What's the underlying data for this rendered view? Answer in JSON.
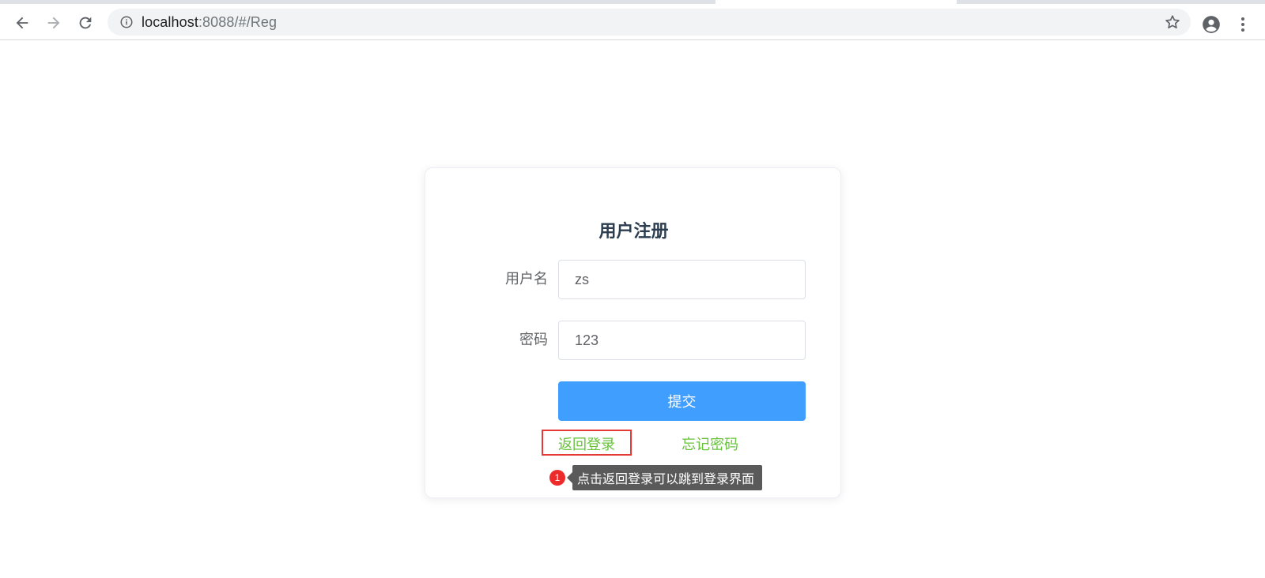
{
  "browser": {
    "url_host": "localhost",
    "url_path": ":8088/#/Reg",
    "icons": {
      "back": "arrow-left-icon",
      "forward": "arrow-right-icon",
      "reload": "reload-icon",
      "info": "info-icon",
      "bookmark": "star-icon",
      "profile": "account-icon",
      "menu": "more-vert-icon"
    }
  },
  "register": {
    "title": "用户注册",
    "username_label": "用户名",
    "username_value": "zs",
    "password_label": "密码",
    "password_value": "123",
    "submit_label": "提交",
    "back_to_login": "返回登录",
    "forgot_password": "忘记密码"
  },
  "annotation": {
    "number": "1",
    "text": "点击返回登录可以跳到登录界面"
  },
  "colors": {
    "primary": "#409eff",
    "link": "#67c23a",
    "highlight": "#e53935",
    "title": "#2c3e50"
  }
}
